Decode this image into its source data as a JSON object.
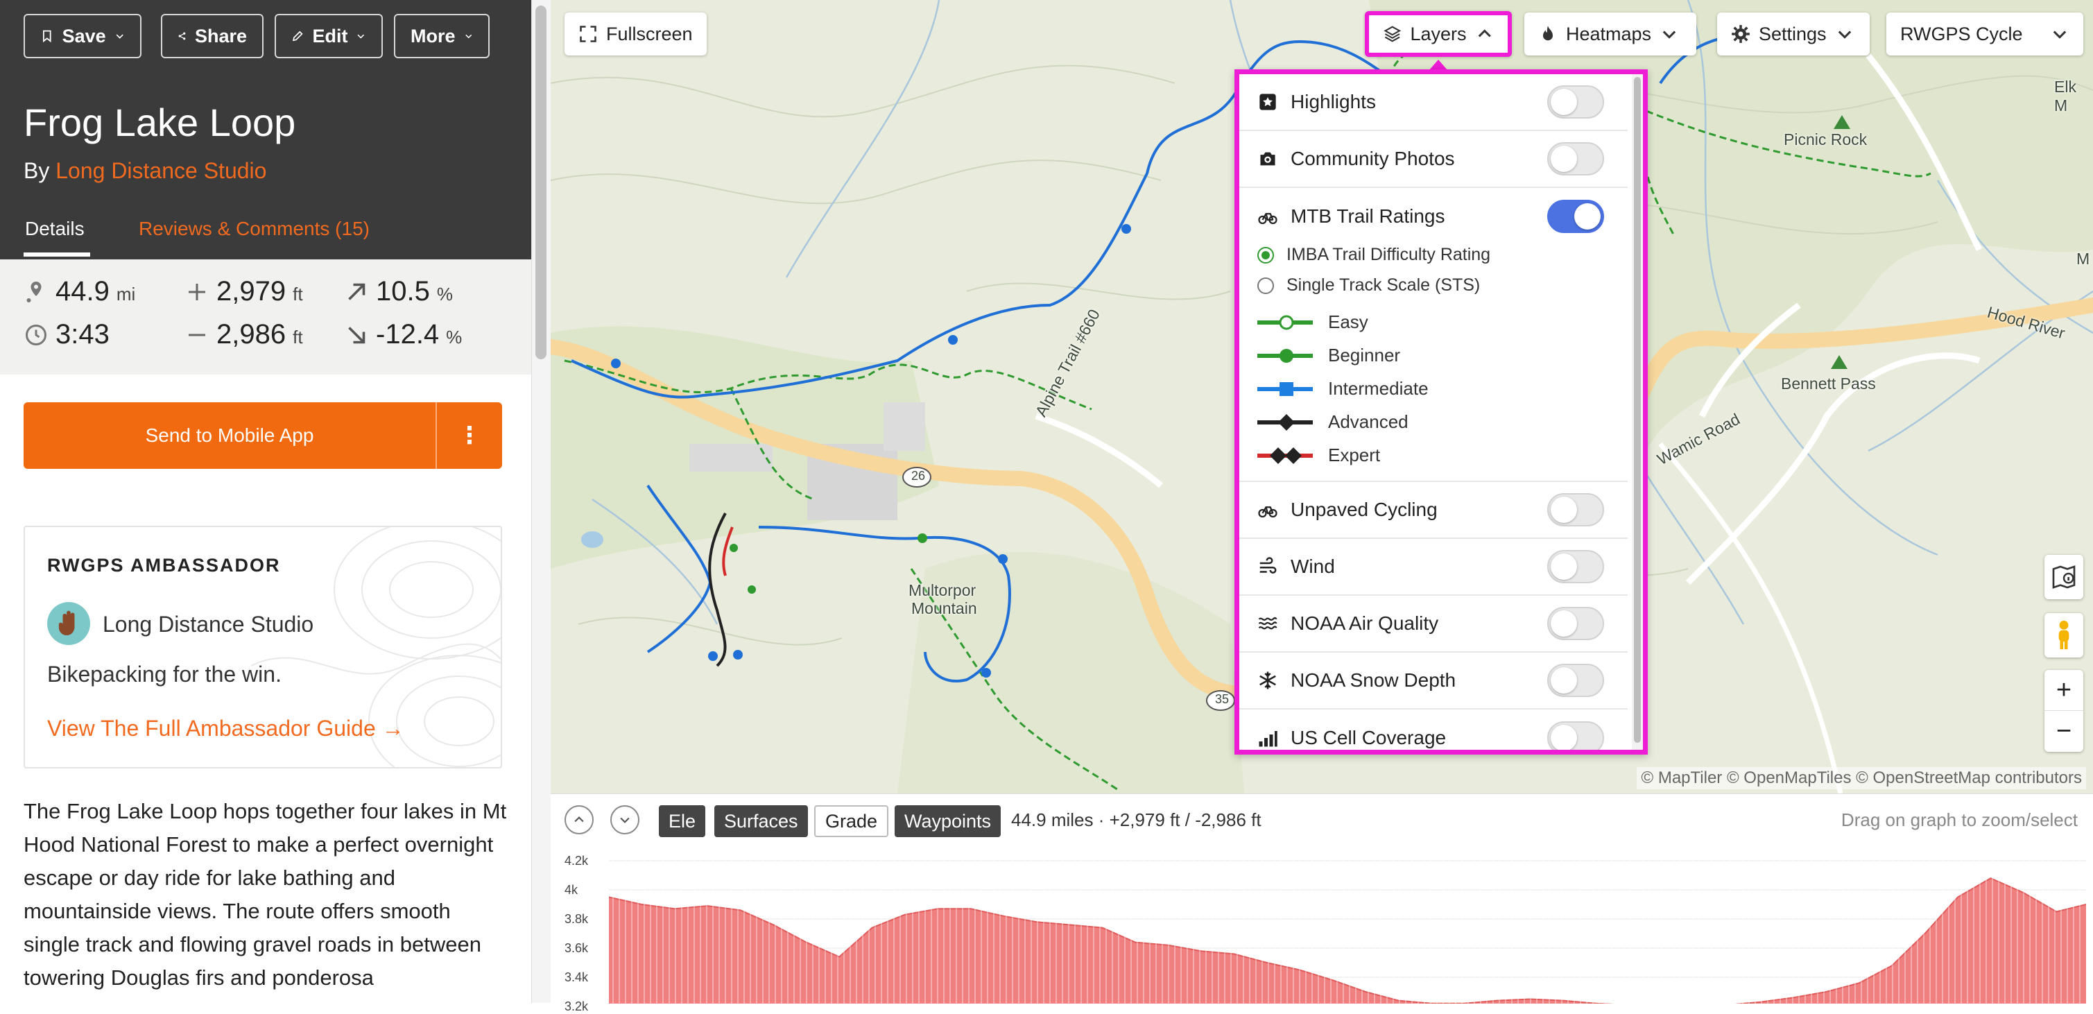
{
  "toolbar": {
    "save_label": "Save",
    "share_label": "Share",
    "edit_label": "Edit",
    "more_label": "More"
  },
  "route": {
    "title": "Frog Lake Loop",
    "by_prefix": "By",
    "author": "Long Distance Studio"
  },
  "tabs": {
    "details": "Details",
    "reviews": "Reviews & Comments (15)"
  },
  "stats": {
    "distance": "44.9",
    "distance_unit": "mi",
    "elev_gain": "2,979",
    "elev_gain_unit": "ft",
    "grade_up": "10.5",
    "grade_up_unit": "%",
    "time": "3:43",
    "elev_loss": "2,986",
    "elev_loss_unit": "ft",
    "grade_down": "-12.4",
    "grade_down_unit": "%"
  },
  "send": {
    "label": "Send to Mobile App",
    "more_label": "⋮"
  },
  "ambassador": {
    "heading": "RWGPS AMBASSADOR",
    "name": "Long Distance Studio",
    "tagline": "Bikepacking for the win.",
    "guide_link": "View The Full Ambassador Guide →"
  },
  "description": "The Frog Lake Loop hops together four lakes in Mt Hood National Forest to make a perfect overnight escape or day ride for lake bathing and mountainside views. The route offers smooth single track and flowing gravel roads in between towering Douglas firs and ponderosa",
  "map": {
    "fullscreen_label": "Fullscreen",
    "layers_label": "Layers",
    "heatmaps_label": "Heatmaps",
    "settings_label": "Settings",
    "basemap_label": "RWGPS Cycle",
    "attribution": "© MapTiler © OpenMapTiles © OpenStreetMap contributors",
    "labels": {
      "picnic_rock": "Picnic Rock",
      "bennett_pass": "Bennett Pass",
      "hood_river": "Hood River",
      "wamic_road": "Wamic Road",
      "alpine_trail": "Alpine Trail #660",
      "multorpor": "Multorpor",
      "mountain": "Mountain",
      "elk": "Elk M",
      "route_26": "26",
      "route_35": "35",
      "m_edge": "M"
    },
    "zoom_in": "+",
    "zoom_out": "−"
  },
  "layers": {
    "items": [
      {
        "label": "Highlights",
        "on": false
      },
      {
        "label": "Community Photos",
        "on": false
      },
      {
        "label": "MTB Trail Ratings",
        "on": true
      },
      {
        "label": "Unpaved Cycling",
        "on": false
      },
      {
        "label": "Wind",
        "on": false
      },
      {
        "label": "NOAA Air Quality",
        "on": false
      },
      {
        "label": "NOAA Snow Depth",
        "on": false
      },
      {
        "label": "US Cell Coverage",
        "on": false
      }
    ],
    "rating_options": [
      {
        "label": "IMBA Trail Difficulty Rating",
        "selected": true
      },
      {
        "label": "Single Track Scale (STS)",
        "selected": false
      }
    ],
    "legend": [
      {
        "label": "Easy",
        "color": "#2e9a2e"
      },
      {
        "label": "Beginner",
        "color": "#2e9a2e"
      },
      {
        "label": "Intermediate",
        "color": "#1f7fe0"
      },
      {
        "label": "Advanced",
        "color": "#222222"
      },
      {
        "label": "Expert",
        "color": "#222222"
      }
    ]
  },
  "elevation": {
    "tabs": [
      "Ele",
      "Surfaces",
      "Grade",
      "Waypoints"
    ],
    "active_tabs": [
      "Ele",
      "Surfaces",
      "Waypoints"
    ],
    "summary": "44.9 miles · +2,979 ft / -2,986 ft",
    "hint": "Drag on graph to zoom/select",
    "y_ticks": [
      "4.2k",
      "4k",
      "3.8k",
      "3.6k",
      "3.4k",
      "3.2k"
    ]
  },
  "colors": {
    "accent": "#f26a1f",
    "header_bg": "#3b3b3b",
    "highlight_border": "#ee1cd4",
    "toggle_on": "#4c72e2",
    "elevation_fill": "#f08080"
  },
  "chart_data": {
    "type": "area",
    "title": "",
    "xlabel": "",
    "ylabel": "",
    "ylim": [
      3200,
      4200
    ],
    "x_range_miles": [
      0,
      44.9
    ],
    "series": [
      {
        "x": [
          0,
          1,
          2,
          3,
          4,
          5,
          6,
          7,
          8,
          9,
          10,
          11,
          12,
          13,
          14,
          15,
          16,
          17,
          18,
          19,
          20,
          21,
          22,
          23,
          24,
          25,
          26,
          27,
          28,
          29,
          30,
          31,
          32,
          33,
          34,
          35,
          36,
          37,
          38,
          39,
          40,
          41,
          42,
          43,
          44,
          44.9
        ],
        "values": [
          3950,
          3900,
          3870,
          3890,
          3860,
          3760,
          3640,
          3540,
          3740,
          3830,
          3870,
          3870,
          3820,
          3780,
          3760,
          3740,
          3640,
          3620,
          3580,
          3560,
          3500,
          3450,
          3380,
          3300,
          3240,
          3220,
          3220,
          3240,
          3250,
          3240,
          3220,
          3210,
          3200,
          3200,
          3210,
          3230,
          3260,
          3300,
          3360,
          3480,
          3700,
          3950,
          4080,
          3980,
          3850,
          3900
        ]
      }
    ]
  }
}
